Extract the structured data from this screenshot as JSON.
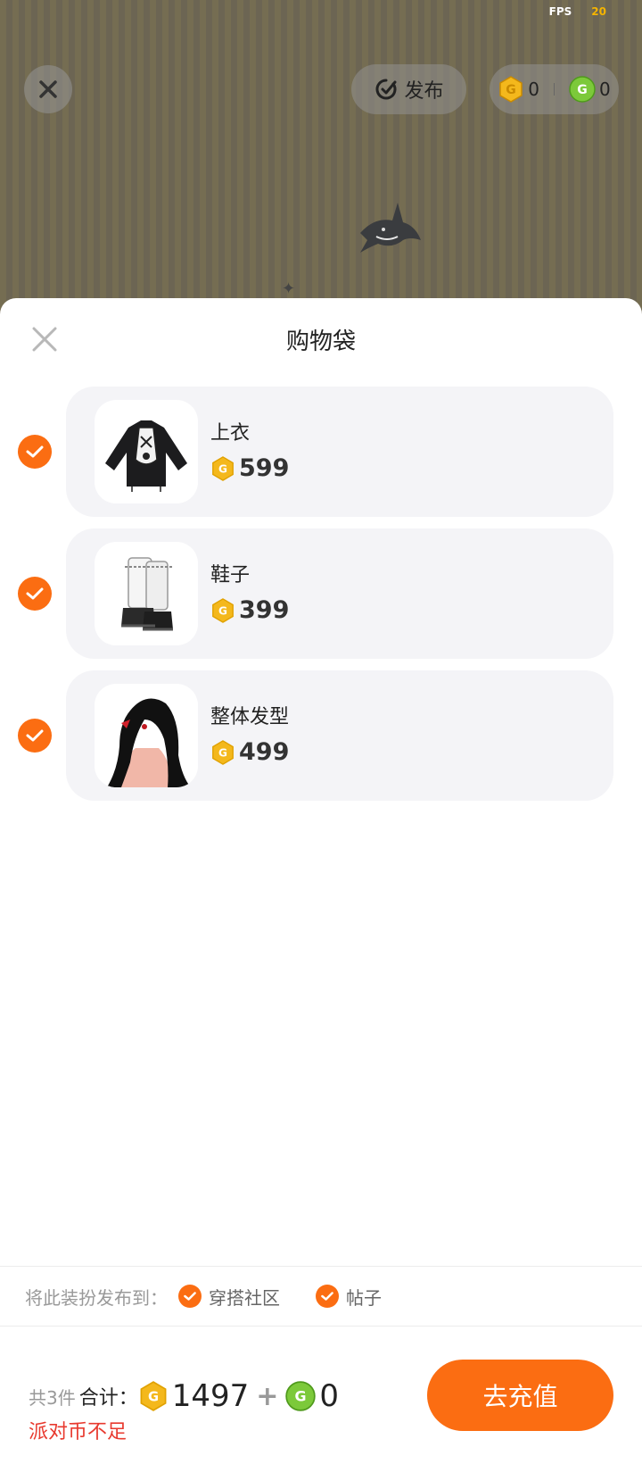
{
  "hud": {
    "fps_label": "FPS",
    "fps_value": "20"
  },
  "top_bar": {
    "publish_label": "发布",
    "gold_balance": "0",
    "green_balance": "0"
  },
  "sheet": {
    "title": "购物袋",
    "items": [
      {
        "name": "上衣",
        "price": "599",
        "icon": "jacket-thumbnail"
      },
      {
        "name": "鞋子",
        "price": "399",
        "icon": "boots-thumbnail"
      },
      {
        "name": "整体发型",
        "price": "499",
        "icon": "hairstyle-thumbnail"
      }
    ]
  },
  "publish_to": {
    "label": "将此装扮发布到：",
    "options": [
      {
        "label": "穿搭社区",
        "checked": true
      },
      {
        "label": "帖子",
        "checked": true
      }
    ]
  },
  "footer": {
    "count_text": "共3件",
    "total_label": "合计：",
    "gold_total": "1497",
    "plus": "+",
    "green_total": "0",
    "warning": "派对币不足",
    "recharge_label": "去充值"
  },
  "colors": {
    "accent": "#fb6d12",
    "gold_coin": "#f4b81c",
    "green_coin": "#7cc93a",
    "warning": "#e83a2f",
    "card_bg": "#f4f4f7"
  }
}
